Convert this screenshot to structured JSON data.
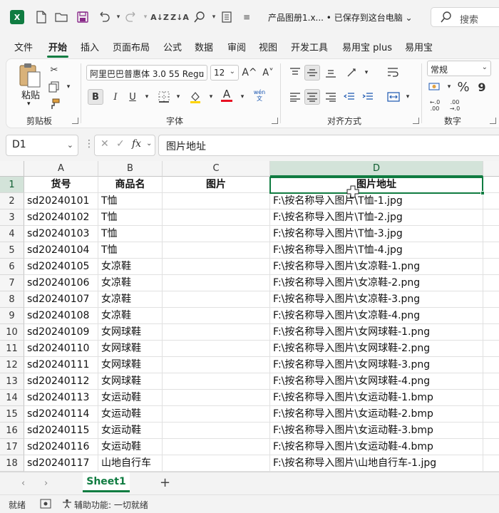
{
  "app": {
    "logo_text": "X",
    "doc_title": "产品图册1.x... • 已保存到这台电脑 ⌄",
    "search_placeholder": "搜索"
  },
  "tabs": [
    "文件",
    "开始",
    "插入",
    "页面布局",
    "公式",
    "数据",
    "审阅",
    "视图",
    "开发工具",
    "易用宝 plus",
    "易用宝"
  ],
  "ribbon": {
    "clipboard": {
      "paste_label": "粘贴",
      "group_label": "剪贴板"
    },
    "font": {
      "font_name": "阿里巴巴普惠体 3.0 55 Regu",
      "font_size": "12",
      "bold": "B",
      "italic": "I",
      "underline": "U",
      "grow": "A^",
      "shrink": "A˅",
      "font_color_letter": "A",
      "wen": "wén\n文",
      "group_label": "字体"
    },
    "alignment": {
      "group_label": "对齐方式"
    },
    "number": {
      "format": "常规",
      "percent": "%",
      "comma": "9",
      "group_label": "数字"
    }
  },
  "formula_bar": {
    "name_box": "D1",
    "fx": "fx",
    "content": "图片地址"
  },
  "columns": [
    "A",
    "B",
    "C",
    "D"
  ],
  "header_row": [
    "货号",
    "商品名",
    "图片",
    "图片地址"
  ],
  "rows": [
    [
      "sd20240101",
      "T恤",
      "",
      "F:\\按名称导入图片\\T恤-1.jpg"
    ],
    [
      "sd20240102",
      "T恤",
      "",
      "F:\\按名称导入图片\\T恤-2.jpg"
    ],
    [
      "sd20240103",
      "T恤",
      "",
      "F:\\按名称导入图片\\T恤-3.jpg"
    ],
    [
      "sd20240104",
      "T恤",
      "",
      "F:\\按名称导入图片\\T恤-4.jpg"
    ],
    [
      "sd20240105",
      "女凉鞋",
      "",
      "F:\\按名称导入图片\\女凉鞋-1.png"
    ],
    [
      "sd20240106",
      "女凉鞋",
      "",
      "F:\\按名称导入图片\\女凉鞋-2.png"
    ],
    [
      "sd20240107",
      "女凉鞋",
      "",
      "F:\\按名称导入图片\\女凉鞋-3.png"
    ],
    [
      "sd20240108",
      "女凉鞋",
      "",
      "F:\\按名称导入图片\\女凉鞋-4.png"
    ],
    [
      "sd20240109",
      "女网球鞋",
      "",
      "F:\\按名称导入图片\\女网球鞋-1.png"
    ],
    [
      "sd20240110",
      "女网球鞋",
      "",
      "F:\\按名称导入图片\\女网球鞋-2.png"
    ],
    [
      "sd20240111",
      "女网球鞋",
      "",
      "F:\\按名称导入图片\\女网球鞋-3.png"
    ],
    [
      "sd20240112",
      "女网球鞋",
      "",
      "F:\\按名称导入图片\\女网球鞋-4.png"
    ],
    [
      "sd20240113",
      "女运动鞋",
      "",
      "F:\\按名称导入图片\\女运动鞋-1.bmp"
    ],
    [
      "sd20240114",
      "女运动鞋",
      "",
      "F:\\按名称导入图片\\女运动鞋-2.bmp"
    ],
    [
      "sd20240115",
      "女运动鞋",
      "",
      "F:\\按名称导入图片\\女运动鞋-3.bmp"
    ],
    [
      "sd20240116",
      "女运动鞋",
      "",
      "F:\\按名称导入图片\\女运动鞋-4.bmp"
    ],
    [
      "sd20240117",
      "山地自行车",
      "",
      "F:\\按名称导入图片\\山地自行车-1.jpg"
    ]
  ],
  "sheets": [
    "Sheet1"
  ],
  "status": {
    "ready": "就绪",
    "accessibility": "辅助功能: 一切就绪"
  },
  "colors": {
    "accent": "#107c41"
  }
}
